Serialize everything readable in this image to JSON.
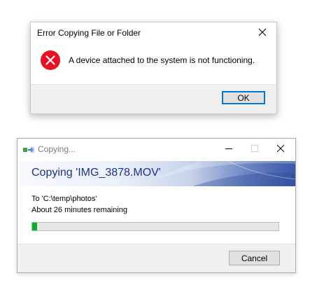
{
  "error_dialog": {
    "title": "Error Copying File or Folder",
    "message": "A device attached to the system is not functioning.",
    "ok_label": "OK",
    "icon": "error-icon",
    "close_icon": "close-icon"
  },
  "copy_dialog": {
    "window_title": "Copying...",
    "heading": "Copying 'IMG_3878.MOV'",
    "destination": "To 'C:\\temp\\photos'",
    "time_remaining": "About 26 minutes remaining",
    "progress_fraction": 0.02,
    "cancel_label": "Cancel",
    "title_buttons": [
      "minimize-icon",
      "maximize-icon",
      "close-icon"
    ]
  },
  "colors": {
    "error_red": "#e81123",
    "progress_green": "#06b025",
    "heading_blue": "#1e3287",
    "button_focus": "#0078d7"
  }
}
